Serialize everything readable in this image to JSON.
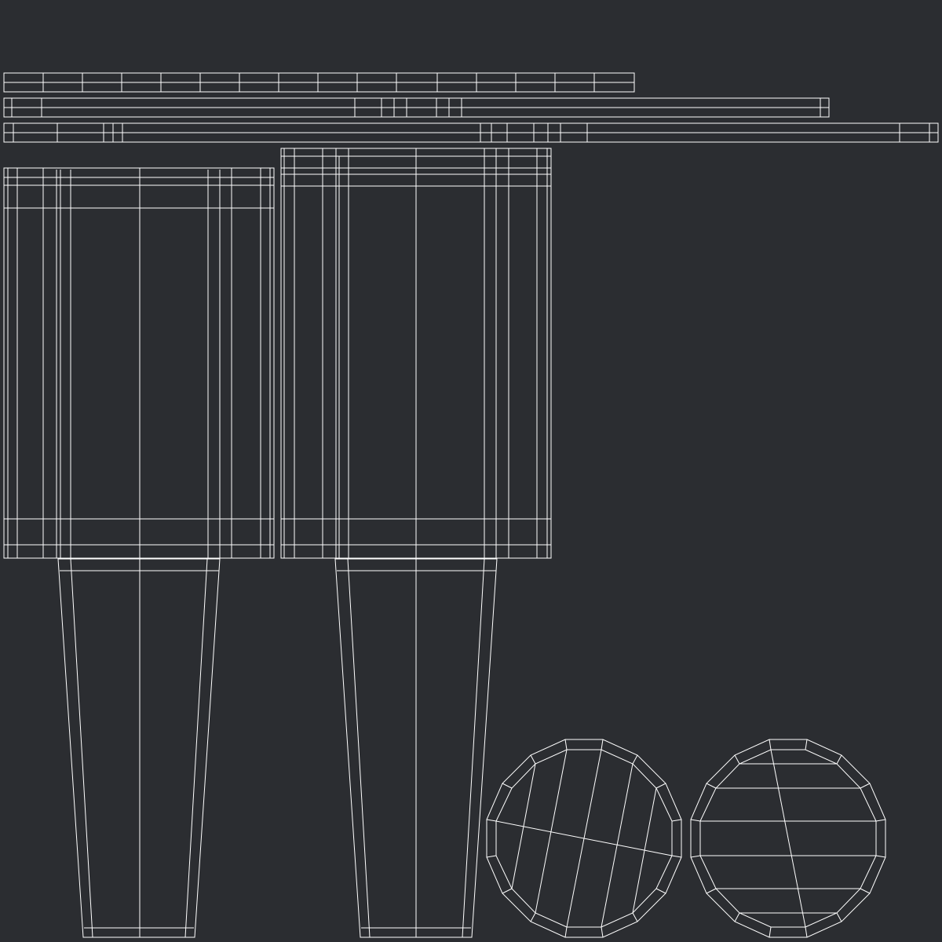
{
  "image": {
    "kind": "uv-wireframe-layout",
    "background_color": "#2b2d31",
    "line_color": "#ffffff"
  },
  "islands": [
    {
      "name": "strip-top"
    },
    {
      "name": "strip-middle"
    },
    {
      "name": "strip-bottom"
    },
    {
      "name": "panel-left"
    },
    {
      "name": "panel-right"
    },
    {
      "name": "tapered-left"
    },
    {
      "name": "tapered-right"
    },
    {
      "name": "disc-left"
    },
    {
      "name": "disc-right"
    }
  ]
}
